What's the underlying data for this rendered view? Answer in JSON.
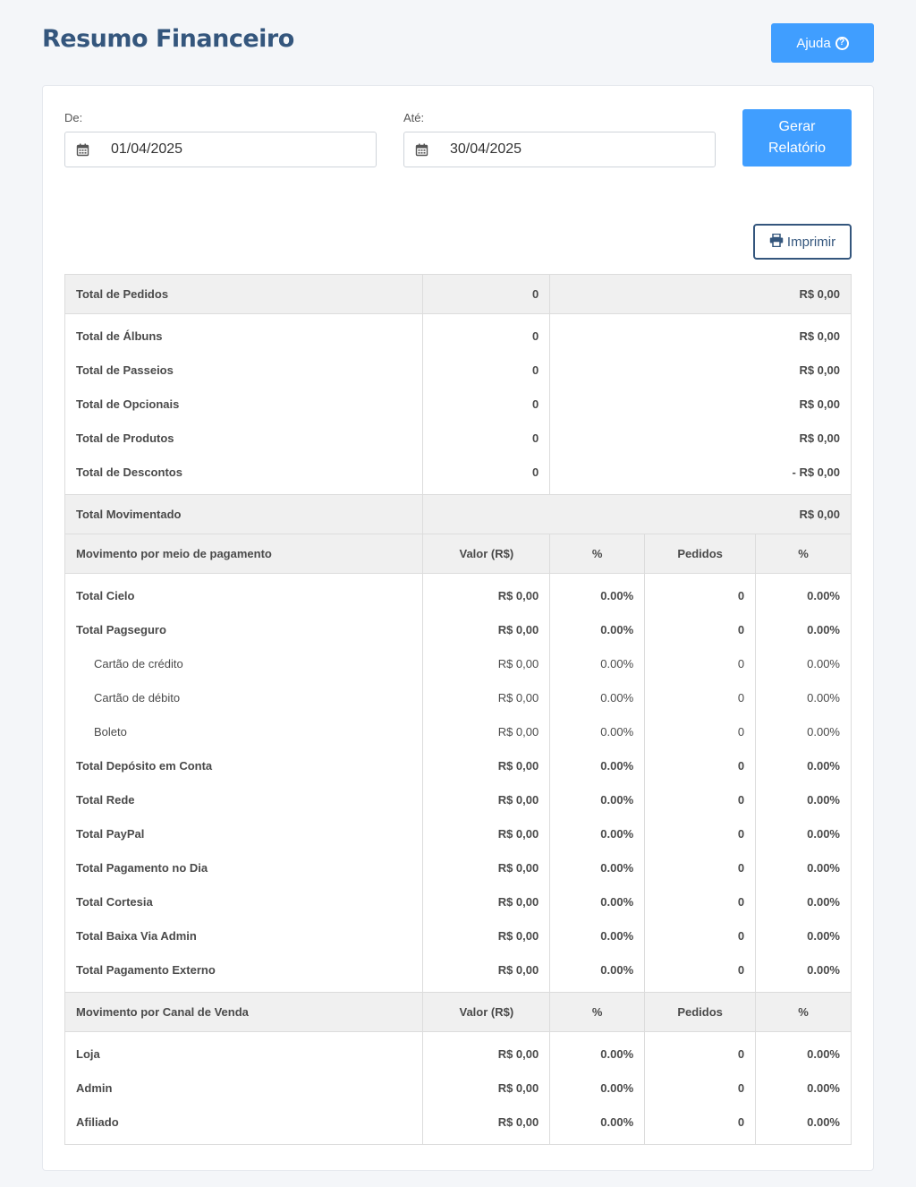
{
  "header": {
    "title": "Resumo Financeiro",
    "help_label": "Ajuda"
  },
  "filters": {
    "from_label": "De:",
    "from_value": "01/04/2025",
    "to_label": "Até:",
    "to_value": "30/04/2025",
    "generate_label": "Gerar Relatório",
    "print_label": "Imprimir"
  },
  "summary": {
    "total_orders": {
      "label": "Total de Pedidos",
      "count": "0",
      "value": "R$ 0,00"
    },
    "items": [
      {
        "label": "Total de Álbuns",
        "count": "0",
        "value": "R$ 0,00"
      },
      {
        "label": "Total de Passeios",
        "count": "0",
        "value": "R$ 0,00"
      },
      {
        "label": "Total de Opcionais",
        "count": "0",
        "value": "R$ 0,00"
      },
      {
        "label": "Total de Produtos",
        "count": "0",
        "value": "R$ 0,00"
      },
      {
        "label": "Total de Descontos",
        "count": "0",
        "value": "- R$ 0,00"
      }
    ],
    "total_moved": {
      "label": "Total Movimentado",
      "value": "R$ 0,00"
    }
  },
  "payments": {
    "headers": [
      "Movimento por meio de pagamento",
      "Valor (R$)",
      "%",
      "Pedidos",
      "%"
    ],
    "rows": [
      {
        "label": "Total Cielo",
        "value": "R$ 0,00",
        "pct": "0.00%",
        "orders": "0",
        "pct2": "0.00%",
        "sub": false
      },
      {
        "label": "Total Pagseguro",
        "value": "R$ 0,00",
        "pct": "0.00%",
        "orders": "0",
        "pct2": "0.00%",
        "sub": false
      },
      {
        "label": "Cartão de crédito",
        "value": "R$ 0,00",
        "pct": "0.00%",
        "orders": "0",
        "pct2": "0.00%",
        "sub": true
      },
      {
        "label": "Cartão de débito",
        "value": "R$ 0,00",
        "pct": "0.00%",
        "orders": "0",
        "pct2": "0.00%",
        "sub": true
      },
      {
        "label": "Boleto",
        "value": "R$ 0,00",
        "pct": "0.00%",
        "orders": "0",
        "pct2": "0.00%",
        "sub": true
      },
      {
        "label": "Total Depósito em Conta",
        "value": "R$ 0,00",
        "pct": "0.00%",
        "orders": "0",
        "pct2": "0.00%",
        "sub": false
      },
      {
        "label": "Total Rede",
        "value": "R$ 0,00",
        "pct": "0.00%",
        "orders": "0",
        "pct2": "0.00%",
        "sub": false
      },
      {
        "label": "Total PayPal",
        "value": "R$ 0,00",
        "pct": "0.00%",
        "orders": "0",
        "pct2": "0.00%",
        "sub": false
      },
      {
        "label": "Total Pagamento no Dia",
        "value": "R$ 0,00",
        "pct": "0.00%",
        "orders": "0",
        "pct2": "0.00%",
        "sub": false
      },
      {
        "label": "Total Cortesia",
        "value": "R$ 0,00",
        "pct": "0.00%",
        "orders": "0",
        "pct2": "0.00%",
        "sub": false
      },
      {
        "label": "Total Baixa Via Admin",
        "value": "R$ 0,00",
        "pct": "0.00%",
        "orders": "0",
        "pct2": "0.00%",
        "sub": false
      },
      {
        "label": "Total Pagamento Externo",
        "value": "R$ 0,00",
        "pct": "0.00%",
        "orders": "0",
        "pct2": "0.00%",
        "sub": false
      }
    ]
  },
  "channels": {
    "headers": [
      "Movimento por Canal de Venda",
      "Valor (R$)",
      "%",
      "Pedidos",
      "%"
    ],
    "rows": [
      {
        "label": "Loja",
        "value": "R$ 0,00",
        "pct": "0.00%",
        "orders": "0",
        "pct2": "0.00%"
      },
      {
        "label": "Admin",
        "value": "R$ 0,00",
        "pct": "0.00%",
        "orders": "0",
        "pct2": "0.00%"
      },
      {
        "label": "Afiliado",
        "value": "R$ 0,00",
        "pct": "0.00%",
        "orders": "0",
        "pct2": "0.00%"
      }
    ]
  },
  "colors": {
    "accent": "#409eff",
    "title": "#34567d"
  },
  "icons": {
    "help": "question-circle-icon",
    "calendar": "calendar-icon",
    "print": "printer-icon"
  }
}
